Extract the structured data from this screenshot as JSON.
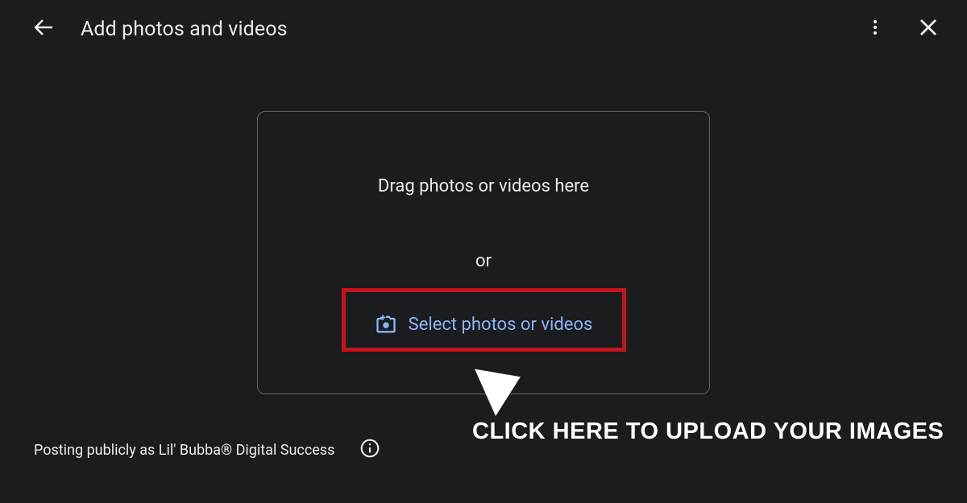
{
  "header": {
    "title": "Add photos and videos"
  },
  "dropzone": {
    "drag_text": "Drag photos or videos here",
    "or_text": "or",
    "select_label": "Select photos or videos"
  },
  "annotation": {
    "label": "Click here to upload your images"
  },
  "footer": {
    "posting_text": "Posting publicly as Lil' Bubba® Digital Success"
  },
  "colors": {
    "background": "#1b1c1e",
    "text": "#e8eaed",
    "link": "#8ab4f8",
    "highlight_border": "#c4141b"
  }
}
